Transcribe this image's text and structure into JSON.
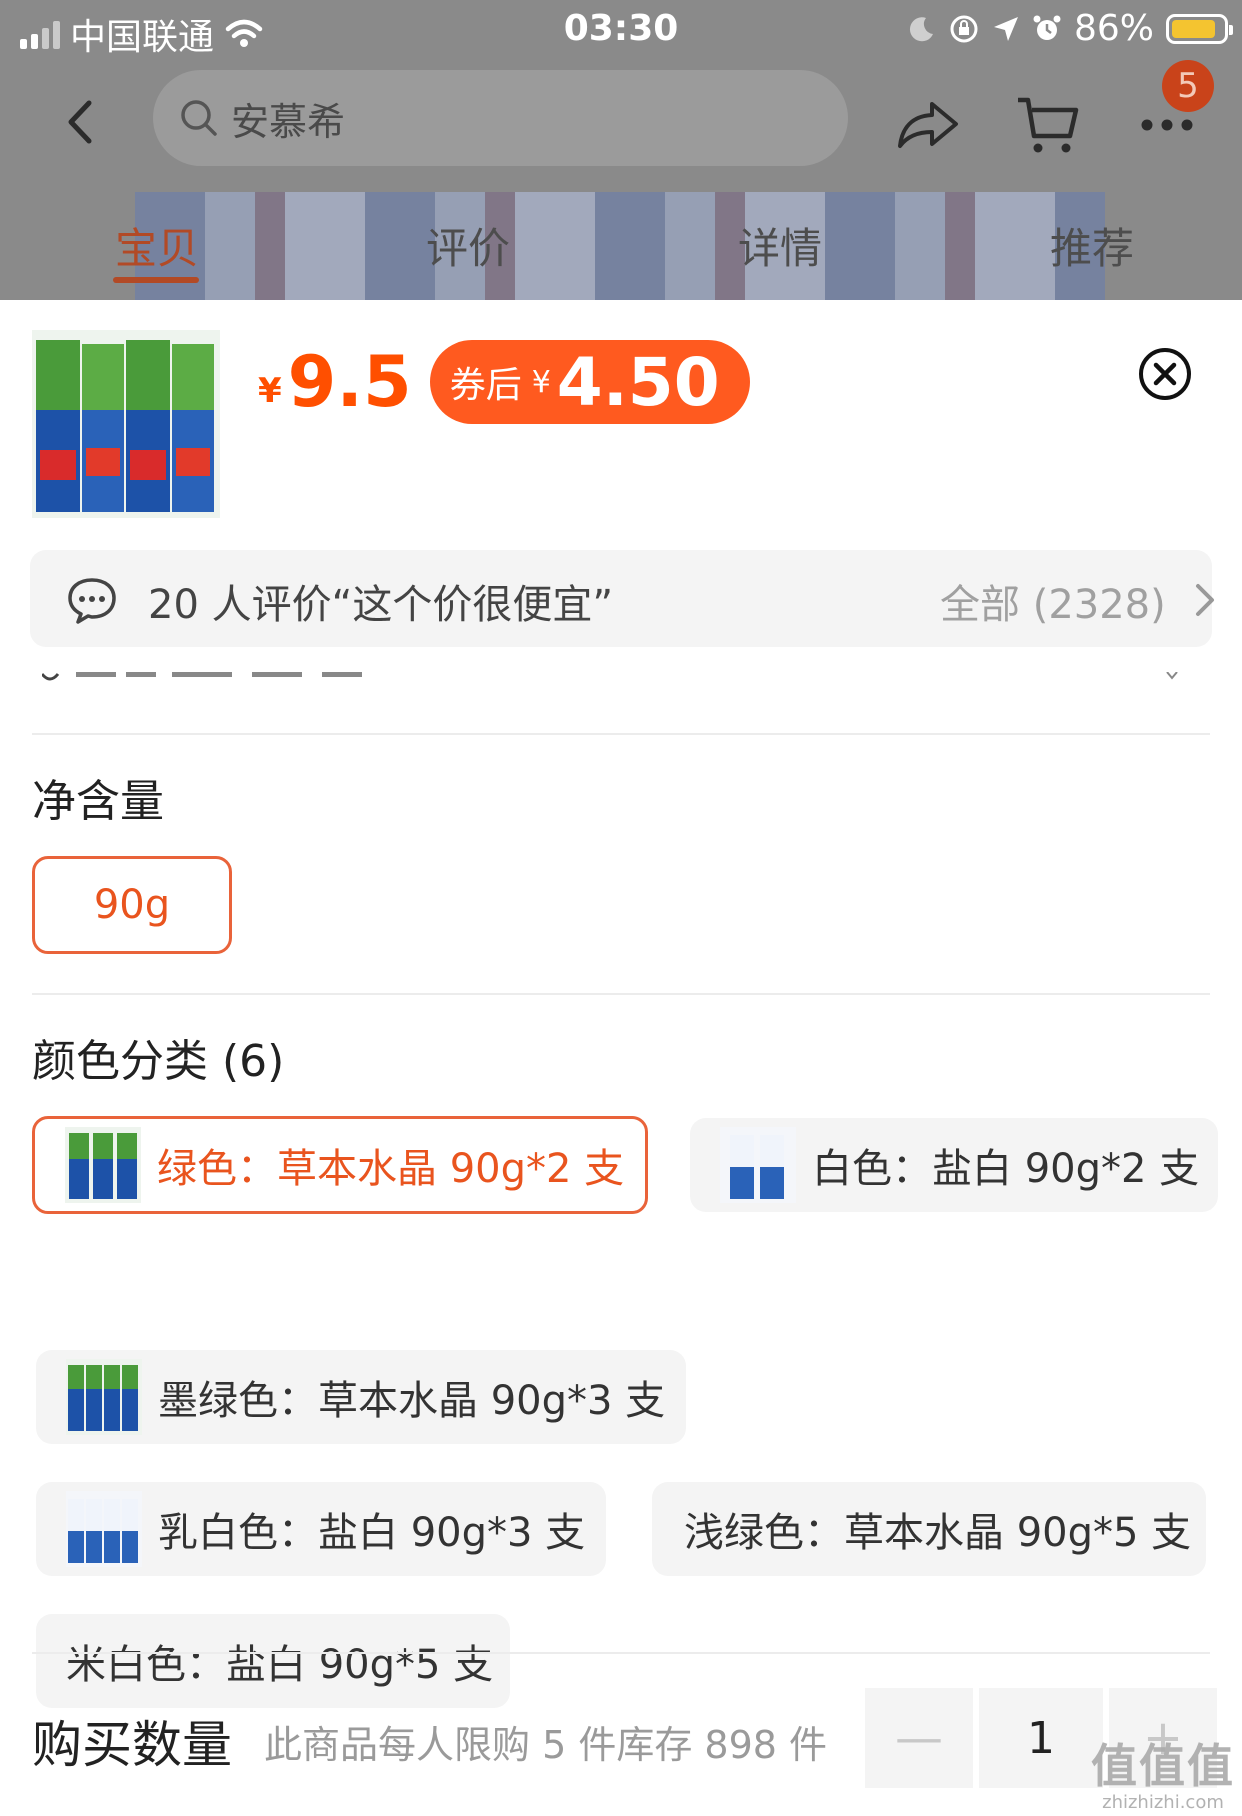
{
  "status_bar": {
    "carrier": "中国联通",
    "time": "03:30",
    "battery": "86%",
    "battery_level": 0.86,
    "icons": [
      "signal-icon",
      "wifi-icon",
      "moon-icon",
      "rotation-lock-icon",
      "location-icon",
      "alarm-icon",
      "battery-icon"
    ]
  },
  "nav": {
    "search_text": "安慕希",
    "badge_count": "5",
    "icons": [
      "back-icon",
      "search-icon",
      "share-icon",
      "cart-icon",
      "more-icon"
    ]
  },
  "tabs": [
    {
      "label": "宝贝",
      "active": true
    },
    {
      "label": "评价",
      "active": false
    },
    {
      "label": "详情",
      "active": false
    },
    {
      "label": "推荐",
      "active": false
    }
  ],
  "sheet": {
    "currency": "¥",
    "price": "9.5",
    "coupon_label": "券后",
    "coupon_currency": "¥",
    "coupon_price": "4.50",
    "review": {
      "text": "20 人评价“这个价很便宜”",
      "all": "全部 (2328)"
    },
    "net_content": {
      "title": "净含量",
      "options": [
        "90g"
      ],
      "selected": "90g"
    },
    "color": {
      "title": "颜色分类 (6)",
      "options": [
        {
          "label": "绿色：草本水晶 90g*2 支",
          "selected": true
        },
        {
          "label": "白色：盐白 90g*2 支",
          "selected": false
        },
        {
          "label": "墨绿色：草本水晶 90g*3 支",
          "selected": false
        },
        {
          "label": "乳白色：盐白 90g*3 支",
          "selected": false
        },
        {
          "label": "浅绿色：草本水晶 90g*5 支",
          "selected": false
        },
        {
          "label": "米白色：盐白 90g*5 支",
          "selected": false
        }
      ]
    },
    "quantity": {
      "label": "购买数量",
      "note": "此商品每人限购 5 件库存 898 件",
      "value": "1",
      "minus": "—",
      "plus": "+"
    }
  },
  "watermark": {
    "text": "值值值",
    "url": "zhizhizhi.com"
  }
}
